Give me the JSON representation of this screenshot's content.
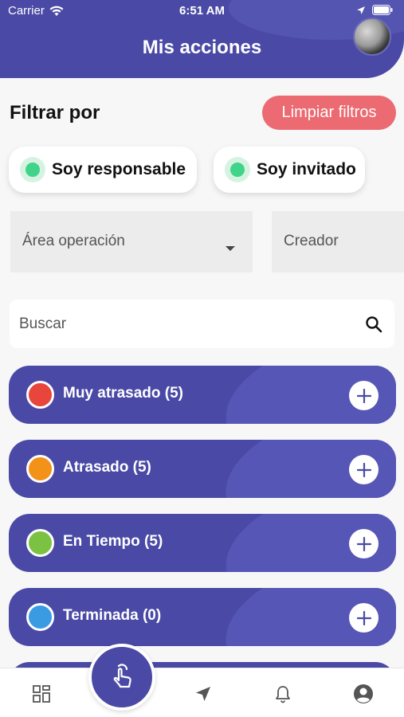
{
  "status_bar": {
    "carrier": "Carrier",
    "time": "6:51 AM"
  },
  "header": {
    "title": "Mis acciones"
  },
  "filters": {
    "title": "Filtrar por",
    "clear_label": "Limpiar filtros",
    "chips": [
      {
        "label": "Soy responsable"
      },
      {
        "label": "Soy invitado"
      }
    ],
    "area_placeholder": "Área operación",
    "creator_placeholder": "Creador",
    "search_placeholder": "Buscar"
  },
  "status_groups": [
    {
      "label": "Muy atrasado (5)",
      "color": "#e8453c"
    },
    {
      "label": "Atrasado (5)",
      "color": "#f39219"
    },
    {
      "label": "En Tiempo (5)",
      "color": "#7cc242"
    },
    {
      "label": "Terminada (0)",
      "color": "#3a9be3"
    }
  ],
  "colors": {
    "primary": "#4a4aa6",
    "accent_red": "#ec6a71",
    "chip_dot": "#3fd48a"
  },
  "bottom_nav": {
    "items": [
      "grid-icon",
      "touch-icon",
      "navigation-icon",
      "bell-icon",
      "user-icon"
    ]
  }
}
